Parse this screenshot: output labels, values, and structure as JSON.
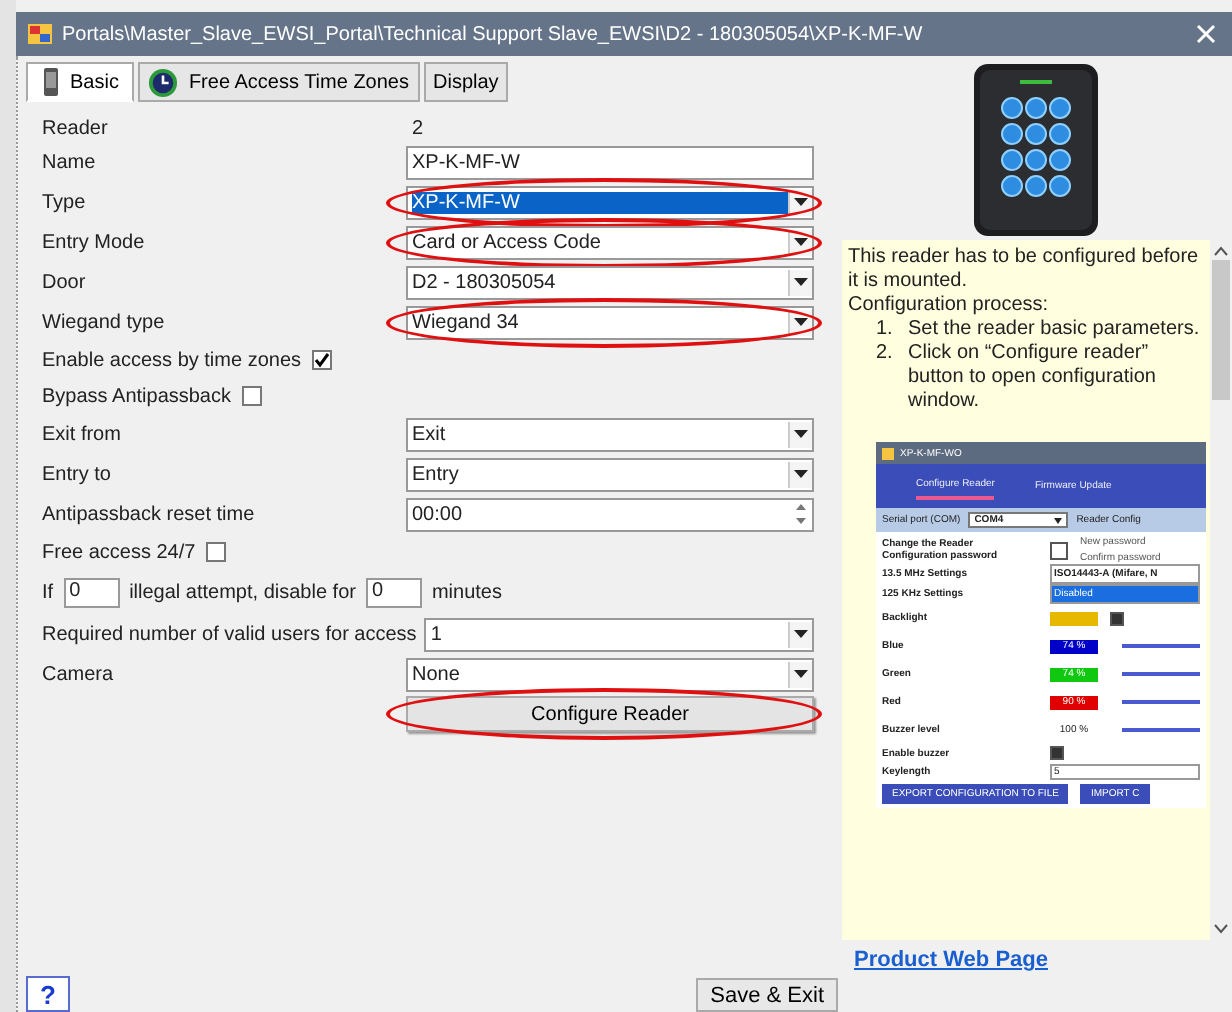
{
  "window": {
    "title": "Portals\\Master_Slave_EWSI_Portal\\Technical Support Slave_EWSI\\D2 - 180305054\\XP-K-MF-W"
  },
  "tabs": [
    {
      "label": "Basic",
      "kind": "reader",
      "selected": true
    },
    {
      "label": "Free Access Time Zones",
      "kind": "clock",
      "selected": false
    },
    {
      "label": "Display",
      "kind": "plain",
      "selected": false
    }
  ],
  "form": [
    {
      "kind": "info",
      "label": "Reader",
      "value": "2"
    },
    {
      "kind": "text",
      "label": "Name",
      "value": "XP-K-MF-W",
      "highlighted": false
    },
    {
      "kind": "select",
      "label": "Type",
      "value": "XP-K-MF-W",
      "focused": true,
      "highlighted": true
    },
    {
      "kind": "select",
      "label": "Entry Mode",
      "value": "Card or Access Code",
      "focused": false,
      "highlighted": true
    },
    {
      "kind": "select",
      "label": "Door",
      "value": "D2 - 180305054",
      "focused": false,
      "highlighted": false
    },
    {
      "kind": "select",
      "label": "Wiegand type",
      "value": "Wiegand 34",
      "focused": false,
      "highlighted": true
    },
    {
      "kind": "check",
      "label": "Enable access by time zones",
      "checked": true
    },
    {
      "kind": "check",
      "label": "Bypass Antipassback",
      "checked": false
    },
    {
      "kind": "select",
      "label": "Exit from",
      "value": "Exit",
      "focused": false,
      "highlighted": false
    },
    {
      "kind": "select",
      "label": "Entry to",
      "value": "Entry",
      "focused": false,
      "highlighted": false
    },
    {
      "kind": "spin",
      "label": "Antipassback reset time",
      "value": "00:00",
      "highlighted": false
    },
    {
      "kind": "check",
      "label": "Free access 24/7",
      "checked": false
    },
    {
      "kind": "attempts",
      "prefix": "If",
      "attempts": "0",
      "middle": "illegal attempt, disable for",
      "minutes": "0",
      "suffix": "minutes"
    },
    {
      "kind": "select",
      "label": "Required number of valid users for access",
      "value": "1",
      "focused": false,
      "highlighted": false
    },
    {
      "kind": "select",
      "label": "Camera",
      "value": "None",
      "focused": false,
      "highlighted": false
    },
    {
      "kind": "button",
      "label": "Configure Reader",
      "highlighted": true
    }
  ],
  "guide": {
    "intro": "This reader has to be configured before it is mounted.",
    "heading": "Configuration process:",
    "steps": [
      {
        "number": "1.",
        "text": "Set the reader basic parameters."
      },
      {
        "number": "2.",
        "text": "Click on “Configure reader” button to open configuration window."
      }
    ],
    "screenshot": {
      "title": "XP-K-MF-WO",
      "tabs": [
        {
          "label": "Configure Reader",
          "selected": true
        },
        {
          "label": "Firmware Update",
          "selected": false
        }
      ],
      "port_label": "Serial port (COM)",
      "port": "COM4",
      "config_label": "Reader Config",
      "password_label": "Change the Reader Configuration password",
      "password_checked": false,
      "new_password": "New password",
      "confirm_password": "Confirm password",
      "settings": [
        {
          "label": "13.5 MHz Settings",
          "value": "ISO14443-A (Mifare, N",
          "focused": false
        },
        {
          "label": "125 KHz Settings",
          "value": "Disabled",
          "focused": true
        }
      ],
      "backlight": {
        "label": "Backlight",
        "color": "#e6b800",
        "checked": true
      },
      "colors": [
        {
          "label": "Blue",
          "reading": "74 %",
          "color": "#0000c8"
        },
        {
          "label": "Green",
          "reading": "74 %",
          "color": "#10c810"
        },
        {
          "label": "Red",
          "reading": "90 %",
          "color": "#e00000"
        }
      ],
      "buzzer": {
        "label": "Buzzer level",
        "reading": "100 %"
      },
      "enable_buzzer": {
        "label": "Enable buzzer",
        "checked": true
      },
      "keylength": {
        "label": "Keylength",
        "value": "5"
      },
      "buttons": [
        "EXPORT CONFIGURATION TO FILE",
        "IMPORT C"
      ]
    }
  },
  "link": "Product Web Page",
  "help": "?",
  "save": "Save & Exit"
}
